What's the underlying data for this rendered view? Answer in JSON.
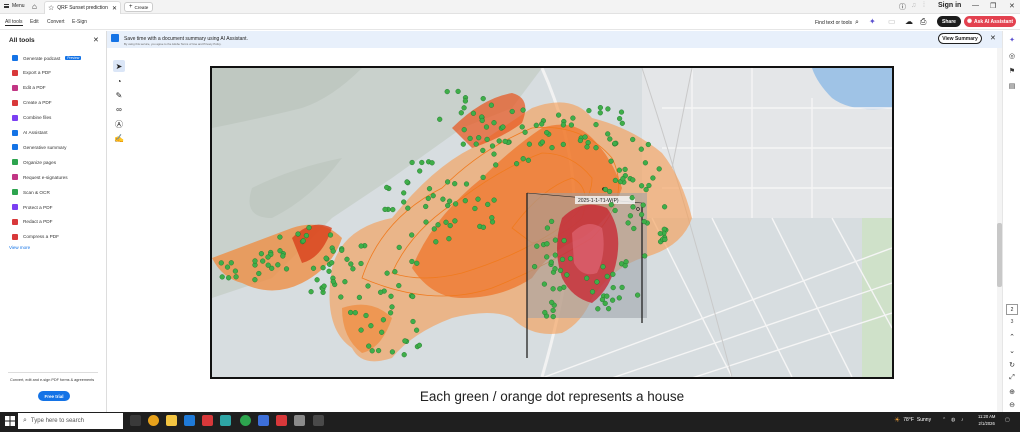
{
  "titlebar": {
    "menu_label": "Menu",
    "tab_title": "QRF Sunset prediction 3...",
    "create_label": "Create",
    "signin_label": "Sign in"
  },
  "toolbar": {
    "nav": [
      "All tools",
      "Edit",
      "Convert",
      "E-Sign"
    ],
    "find_label": "Find text or tools",
    "share_label": "Share",
    "ask_label": "Ask AI Assistant"
  },
  "left_panel": {
    "title": "All tools",
    "items": [
      {
        "label": "Generate podcast",
        "badge": "Preview",
        "color": "#1473e6"
      },
      {
        "label": "Export a PDF",
        "badge": "",
        "color": "#d8383a"
      },
      {
        "label": "Edit a PDF",
        "badge": "",
        "color": "#c13584"
      },
      {
        "label": "Create a PDF",
        "badge": "",
        "color": "#d8383a"
      },
      {
        "label": "Combine files",
        "badge": "",
        "color": "#7b3ff2"
      },
      {
        "label": "AI Assistant",
        "badge": "",
        "color": "#1473e6"
      },
      {
        "label": "Generative summary",
        "badge": "",
        "color": "#1473e6"
      },
      {
        "label": "Organize pages",
        "badge": "",
        "color": "#2da44e"
      },
      {
        "label": "Request e-signatures",
        "badge": "",
        "color": "#c13584"
      },
      {
        "label": "Scan & OCR",
        "badge": "",
        "color": "#2da44e"
      },
      {
        "label": "Protect a PDF",
        "badge": "",
        "color": "#7b3ff2"
      },
      {
        "label": "Redact a PDF",
        "badge": "",
        "color": "#d8383a"
      },
      {
        "label": "Compress a PDF",
        "badge": "",
        "color": "#d8383a"
      }
    ],
    "view_more": "View more",
    "footer": "Convert, edit and e-sign PDF forms & agreements",
    "free_trial": "Free trial"
  },
  "banner": {
    "title": "Save time with a document summary using AI Assistant.",
    "subtitle": "By using this service, you agree to the Adobe Terms of Use and Privacy Policy.",
    "button": "View Summary"
  },
  "document": {
    "map_label": "2025-1-1-T1-W(P)",
    "caption": "Each green / orange dot represents a house"
  },
  "right_rail": {
    "page_current": "2",
    "page_total": "3"
  },
  "taskbar": {
    "search_placeholder": "Type here to search",
    "temperature": "78°F",
    "weather": "Sunny",
    "time": "11:20 AM",
    "date": "2/1/2026"
  },
  "colors": {
    "accent": "#1473e6",
    "ask_ai": "#e3414f",
    "house_dot": "#3fae49",
    "fire_orange": "#f07a1e",
    "burn_red": "#c8202d"
  }
}
